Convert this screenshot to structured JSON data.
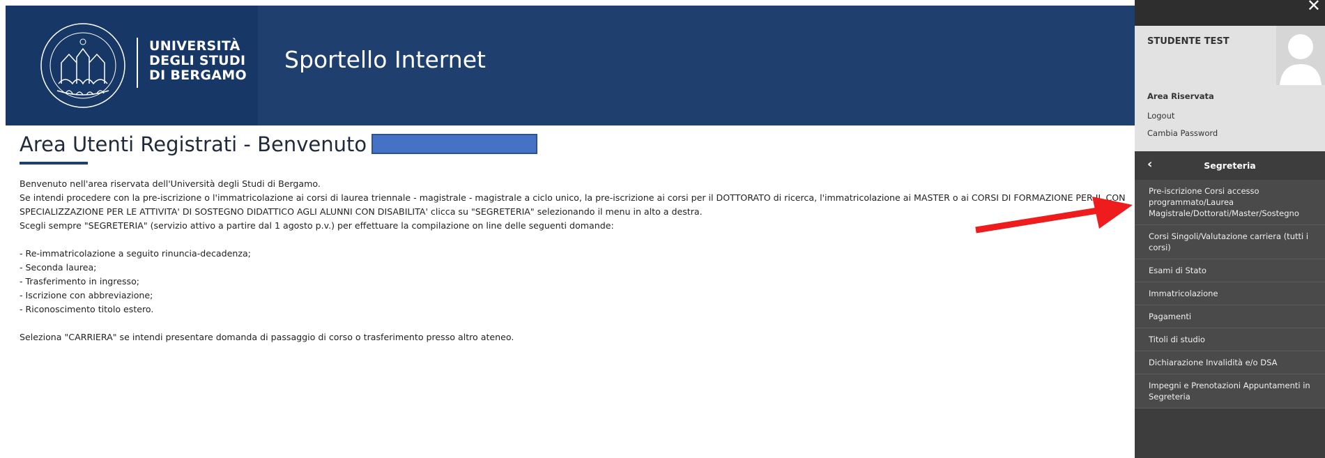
{
  "header": {
    "logo_lines": [
      "UNIVERSITÀ",
      "DEGLI STUDI",
      "DI BERGAMO"
    ],
    "portal_title": "Sportello Internet"
  },
  "main": {
    "title": "Area Utenti Registrati - Benvenuto",
    "paragraphs": [
      "Benvenuto nell'area riservata dell'Università degli Studi di Bergamo.",
      "Se intendi procedere con la pre-iscrizione o l'immatricolazione ai corsi di laurea triennale - magistrale - magistrale a ciclo unico, la pre-iscrizione ai corsi per il DOTTORATO di ricerca, l'immatricolazione ai MASTER o ai CORSI DI FORMAZIONE PER IL CON",
      "SPECIALIZZAZIONE PER LE ATTIVITA' DI SOSTEGNO DIDATTICO AGLI ALUNNI CON DISABILITA' clicca su \"SEGRETERIA\" selezionando il menu in alto a destra.",
      "Scegli sempre \"SEGRETERIA\" (servizio attivo a partire dal 1 agosto p.v.) per effettuare la compilazione on line delle seguenti domande:",
      "- Re-immatricolazione a seguito rinuncia-decadenza;",
      "- Seconda laurea;",
      "- Trasferimento in ingresso;",
      "- Iscrizione con abbreviazione;",
      "- Riconoscimento titolo estero.",
      "Seleziona \"CARRIERA\" se intendi presentare domanda di passaggio di corso o trasferimento presso altro ateneo."
    ]
  },
  "panel": {
    "close_glyph": "✕",
    "user_name": "STUDENTE TEST",
    "area_riservata": "Area Riservata",
    "logout": "Logout",
    "cambia_password": "Cambia Password",
    "section_title": "Segreteria",
    "back_glyph": "‹",
    "menu_items": [
      "Pre-iscrizione Corsi accesso programmato/Laurea Magistrale/Dottorati/Master/Sostegno",
      "Corsi Singoli/Valutazione carriera (tutti i corsi)",
      "Esami di Stato",
      "Immatricolazione",
      "Pagamenti",
      "Titoli di studio",
      "Dichiarazione Invalidità e/o DSA",
      "Impegni e Prenotazioni Appuntamenti in Segreteria"
    ]
  },
  "colors": {
    "header_bg": "#1f3f6e",
    "panel_bg": "#3d3d3d",
    "annotation_arrow": "#ee1c1c",
    "redaction": "#4472c4"
  }
}
